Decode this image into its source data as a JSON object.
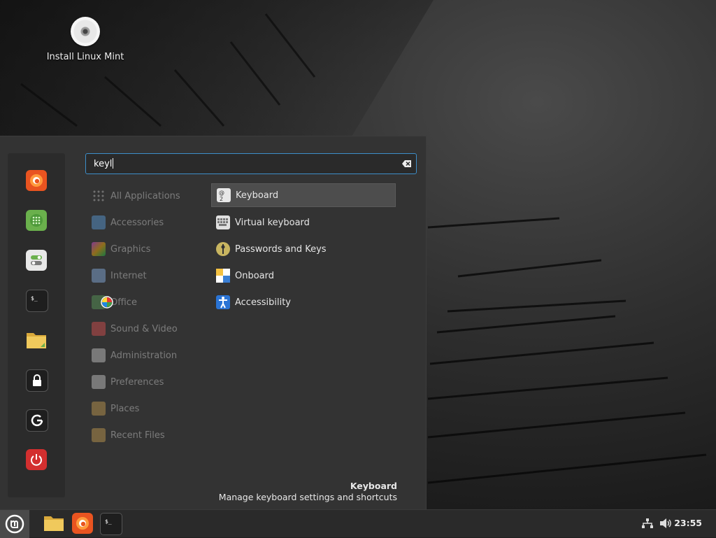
{
  "desktop": {
    "icons": [
      {
        "label": "Install Linux Mint",
        "icon": "disc-icon"
      }
    ]
  },
  "menu": {
    "search": {
      "value": "keyl",
      "clear_icon": "backspace-clear-icon"
    },
    "favorites": [
      {
        "name": "Firefox",
        "icon": "firefox-icon",
        "color": "#e95420"
      },
      {
        "name": "Software Manager",
        "icon": "software-manager-icon",
        "color": "#6ab04c"
      },
      {
        "name": "System Settings",
        "icon": "settings-toggle-icon",
        "color": "#e8e8e8"
      },
      {
        "name": "Terminal",
        "icon": "terminal-icon",
        "color": "#1e1e1e"
      },
      {
        "name": "Files",
        "icon": "folder-icon",
        "color": "#e8c468"
      },
      {
        "name": "Lock Screen",
        "icon": "lock-icon",
        "color": "#1e1e1e"
      },
      {
        "name": "Log Out",
        "icon": "logout-icon",
        "color": "#1e1e1e"
      },
      {
        "name": "Quit",
        "icon": "power-icon",
        "color": "#d32f2f"
      }
    ],
    "categories": [
      {
        "label": "All Applications",
        "icon": "grid-icon"
      },
      {
        "label": "Accessories",
        "icon": "accessories-icon"
      },
      {
        "label": "Graphics",
        "icon": "graphics-icon"
      },
      {
        "label": "Internet",
        "icon": "internet-icon"
      },
      {
        "label": "Office",
        "icon": "office-icon"
      },
      {
        "label": "Sound & Video",
        "icon": "media-icon"
      },
      {
        "label": "Administration",
        "icon": "administration-icon"
      },
      {
        "label": "Preferences",
        "icon": "preferences-icon"
      },
      {
        "label": "Places",
        "icon": "places-folder-icon"
      },
      {
        "label": "Recent Files",
        "icon": "recent-folder-icon"
      }
    ],
    "results": [
      {
        "label": "Keyboard",
        "icon": "keyboard-icon",
        "selected": true
      },
      {
        "label": "Virtual keyboard",
        "icon": "virtual-keyboard-icon",
        "selected": false
      },
      {
        "label": "Passwords and Keys",
        "icon": "passwords-keys-icon",
        "selected": false
      },
      {
        "label": "Onboard",
        "icon": "onboard-icon",
        "selected": false
      },
      {
        "label": "Accessibility",
        "icon": "accessibility-icon",
        "selected": false
      }
    ],
    "description": {
      "title": "Keyboard",
      "text": "Manage keyboard settings and shortcuts"
    }
  },
  "panel": {
    "menu_icon": "linux-mint-logo-icon",
    "launchers": [
      {
        "name": "Files",
        "icon": "folder-icon"
      },
      {
        "name": "Firefox",
        "icon": "firefox-icon"
      },
      {
        "name": "Terminal",
        "icon": "terminal-icon"
      }
    ],
    "tray": {
      "network_icon": "network-icon",
      "volume_icon": "volume-icon"
    },
    "clock": "23:55"
  },
  "colors": {
    "accent": "#3d8ec9",
    "menu_bg": "#333333",
    "panel_bg": "#2a2a2a"
  }
}
